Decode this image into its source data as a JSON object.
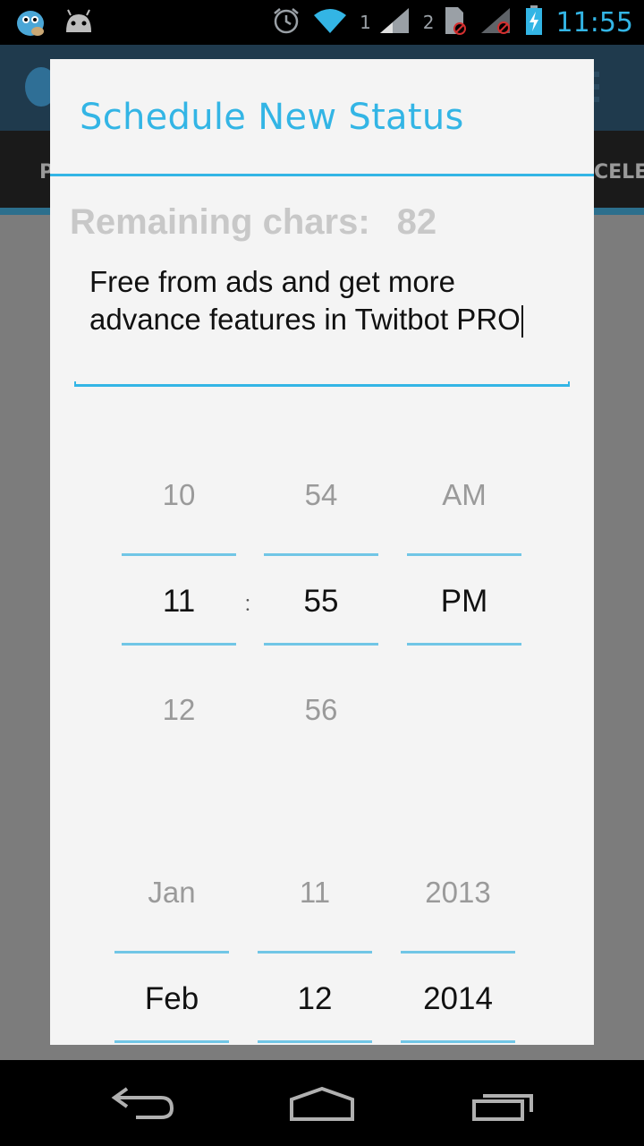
{
  "status_bar": {
    "clock": "11:55",
    "wifi_badge": "1",
    "sim2_badge": "2",
    "icons": [
      "twitbot-app-icon",
      "android-icon",
      "alarm-icon",
      "wifi-icon",
      "signal-icon",
      "sim-icon",
      "signal-no-service-icon",
      "battery-charging-icon"
    ]
  },
  "background_app": {
    "tab_left_fragment": "P",
    "tab_right_fragment": "CELED"
  },
  "dialog": {
    "title": "Schedule New Status",
    "remaining_label": "Remaining chars:",
    "remaining_count": "82",
    "status_text": "Free from ads and get more advance features in Twitbot PRO"
  },
  "time_picker": {
    "hour": {
      "prev": "10",
      "selected": "11",
      "next": "12"
    },
    "separator": ":",
    "minute": {
      "prev": "54",
      "selected": "55",
      "next": "56"
    },
    "ampm": {
      "prev": "AM",
      "selected": "PM"
    }
  },
  "date_picker": {
    "month": {
      "prev": "Jan",
      "selected": "Feb"
    },
    "day": {
      "prev": "11",
      "selected": "12"
    },
    "year": {
      "prev": "2013",
      "selected": "2014"
    }
  },
  "nav_bar": {
    "buttons": [
      "back-icon",
      "home-icon",
      "recents-icon"
    ]
  },
  "colors": {
    "accent": "#33b5e5",
    "picker_divider": "#71c6e6",
    "dialog_bg": "#f4f4f4"
  }
}
